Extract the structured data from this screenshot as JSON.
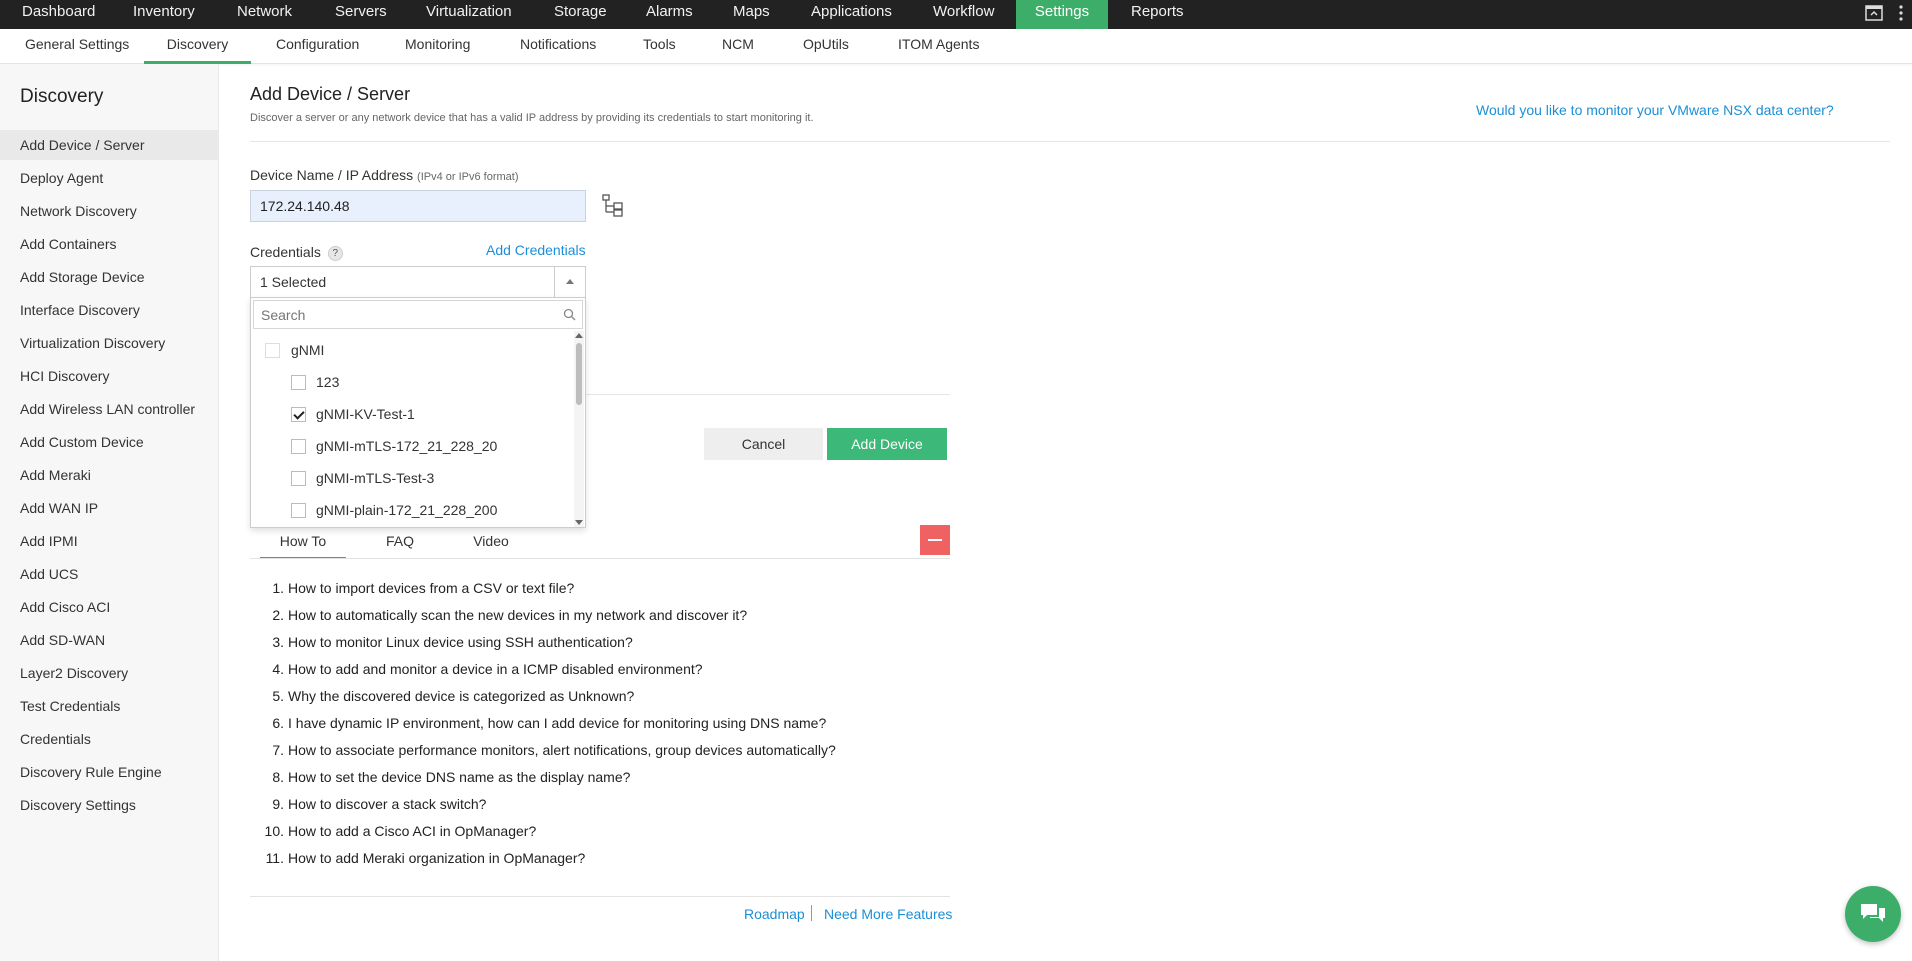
{
  "topnav": {
    "items": [
      "Dashboard",
      "Inventory",
      "Network",
      "Servers",
      "Virtualization",
      "Storage",
      "Alarms",
      "Maps",
      "Applications",
      "Workflow",
      "Settings",
      "Reports"
    ],
    "active": "Settings"
  },
  "subnav": {
    "items": [
      "General Settings",
      "Discovery",
      "Configuration",
      "Monitoring",
      "Notifications",
      "Tools",
      "NCM",
      "OpUtils",
      "ITOM Agents"
    ],
    "active": "Discovery"
  },
  "sidebar": {
    "heading": "Discovery",
    "items": [
      "Add Device / Server",
      "Deploy Agent",
      "Network Discovery",
      "Add Containers",
      "Add Storage Device",
      "Interface Discovery",
      "Virtualization Discovery",
      "HCI Discovery",
      "Add Wireless LAN controller",
      "Add Custom Device",
      "Add Meraki",
      "Add WAN IP",
      "Add IPMI",
      "Add UCS",
      "Add Cisco ACI",
      "Add SD-WAN",
      "Layer2 Discovery",
      "Test Credentials",
      "Credentials",
      "Discovery Rule Engine",
      "Discovery Settings"
    ],
    "active": "Add Device / Server"
  },
  "main": {
    "title": "Add Device / Server",
    "subtitle": "Discover a server or any network device that has a valid IP address by providing its credentials to start monitoring it.",
    "nsx_link": "Would you like to monitor your VMware NSX data center?",
    "device_label": "Device Name / IP Address",
    "device_hint": "(IPv4 or IPv6 format)",
    "device_value": "172.24.140.48",
    "credentials_label": "Credentials",
    "help_glyph": "?",
    "add_credentials": "Add Credentials",
    "credentials_selected": "1 Selected",
    "search_placeholder": "Search",
    "cred_group": "gNMI",
    "cred_options": [
      {
        "label": "123",
        "checked": false
      },
      {
        "label": "gNMI-KV-Test-1",
        "checked": true
      },
      {
        "label": "gNMI-mTLS-172_21_228_20",
        "checked": false
      },
      {
        "label": "gNMI-mTLS-Test-3",
        "checked": false
      },
      {
        "label": "gNMI-plain-172_21_228_200",
        "checked": false
      }
    ],
    "cancel": "Cancel",
    "add_device": "Add Device"
  },
  "help": {
    "tabs": [
      "How To",
      "FAQ",
      "Video"
    ],
    "active_tab": "How To",
    "items": [
      "How to import devices from a CSV or text file?",
      "How to automatically scan the new devices in my network and discover it?",
      "How to monitor Linux device using SSH authentication?",
      "How to add and monitor a device in a ICMP disabled environment?",
      "Why the discovered device is categorized as Unknown?",
      "I have dynamic IP environment, how can I add device for monitoring using DNS name?",
      "How to associate performance monitors, alert notifications, group devices automatically?",
      "How to set the device DNS name as the display name?",
      "How to discover a stack switch?",
      "How to add a Cisco ACI in OpManager?",
      "How to add Meraki organization in OpManager?"
    ],
    "numbers": [
      "1.",
      "2.",
      "3.",
      "4.",
      "5.",
      "6.",
      "7.",
      "8.",
      "9.",
      "10.",
      "11."
    ]
  },
  "footer": {
    "roadmap": "Roadmap",
    "more_features": "Need More Features"
  },
  "colors": {
    "accent_green": "#3cae6a",
    "link_blue": "#1b8fd6",
    "topbar": "#222222",
    "danger": "#f06262"
  }
}
